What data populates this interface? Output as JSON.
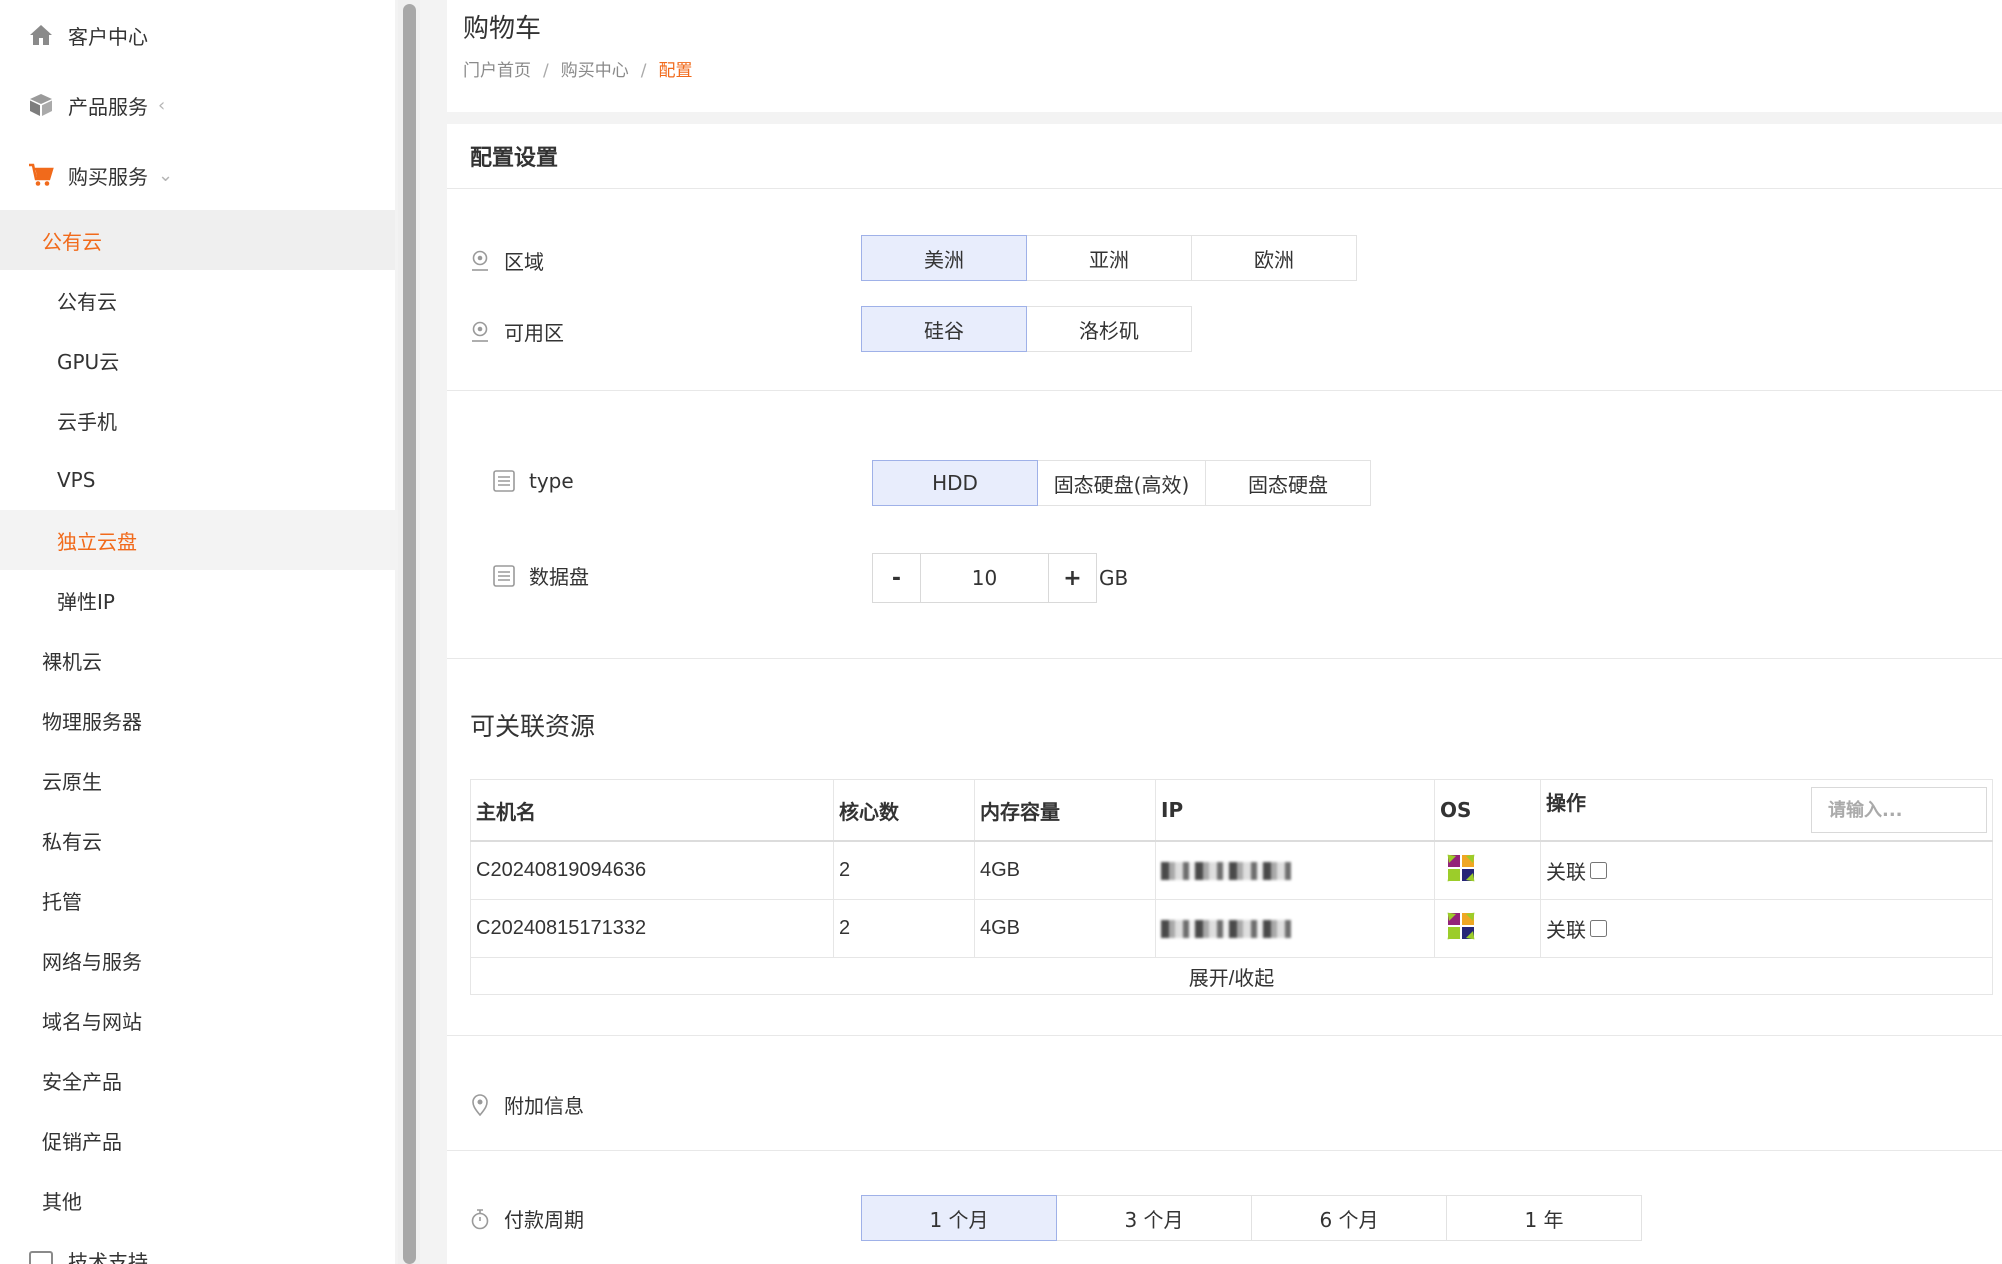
{
  "sidebar": {
    "top": [
      {
        "label": "客户中心",
        "icon": "home-icon"
      },
      {
        "label": "产品服务",
        "icon": "box-icon"
      },
      {
        "label": "购买服务",
        "icon": "cart-icon"
      }
    ],
    "items": [
      {
        "label": "公有云"
      },
      {
        "label": "公有云"
      },
      {
        "label": "GPU云"
      },
      {
        "label": "云手机"
      },
      {
        "label": "VPS"
      },
      {
        "label": "独立云盘"
      },
      {
        "label": "弹性IP"
      },
      {
        "label": "裸机云"
      },
      {
        "label": "物理服务器"
      },
      {
        "label": "云原生"
      },
      {
        "label": "私有云"
      },
      {
        "label": "托管"
      },
      {
        "label": "网络与服务"
      },
      {
        "label": "域名与网站"
      },
      {
        "label": "安全产品"
      },
      {
        "label": "促销产品"
      },
      {
        "label": "其他"
      }
    ],
    "bottom_partial": "技术支持"
  },
  "header": {
    "title": "购物车",
    "breadcrumb": [
      "门户首页",
      "购买中心",
      "配置"
    ]
  },
  "panel": {
    "title": "配置设置",
    "region": {
      "label": "区域",
      "options": [
        "美洲",
        "亚洲",
        "欧洲"
      ],
      "selected": "美洲"
    },
    "zone": {
      "label": "可用区",
      "options": [
        "硅谷",
        "洛杉矶"
      ],
      "selected": "硅谷"
    },
    "type": {
      "label": "type",
      "options": [
        "HDD",
        "固态硬盘(高效)",
        "固态硬盘"
      ],
      "selected": "HDD"
    },
    "disk": {
      "label": "数据盘",
      "minus": "-",
      "plus": "+",
      "value": "10",
      "unit": "GB"
    },
    "resources": {
      "title": "可关联资源",
      "columns": [
        "主机名",
        "核心数",
        "内存容量",
        "IP",
        "OS",
        "操作"
      ],
      "search_placeholder": "请输入...",
      "rows": [
        {
          "host": "C20240819094636",
          "cores": "2",
          "memory": "4GB",
          "ip": "",
          "os": "centos-icon",
          "action": "关联"
        },
        {
          "host": "C20240815171332",
          "cores": "2",
          "memory": "4GB",
          "ip": "",
          "os": "centos-icon",
          "action": "关联"
        }
      ],
      "expand": "展开/收起"
    },
    "extra": {
      "label": "附加信息"
    },
    "billing": {
      "label": "付款周期",
      "options": [
        "1 个月",
        "3 个月",
        "6 个月",
        "1 年"
      ],
      "selected": "1 个月"
    }
  },
  "colors": {
    "accent": "#f16a1b",
    "selected_bg": "#e8edfc",
    "selected_border": "#9fb1e8"
  }
}
